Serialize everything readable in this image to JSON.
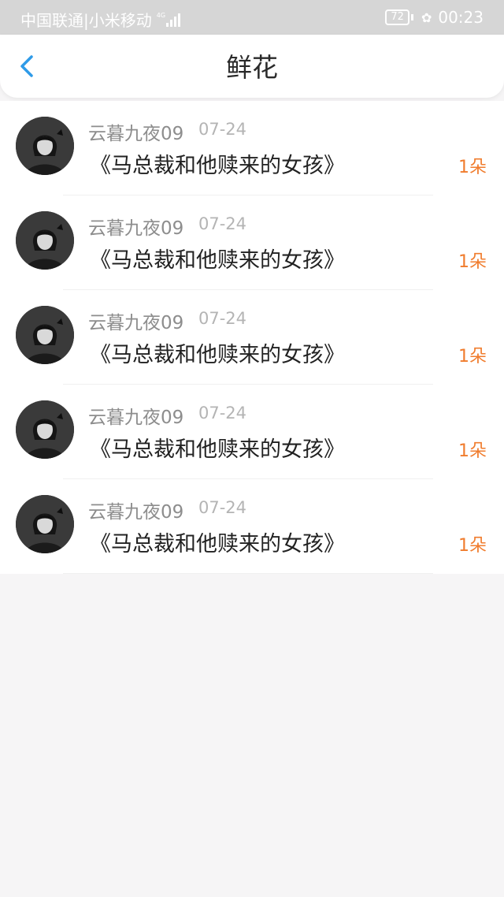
{
  "status_bar": {
    "carriers": "中国联通|小米移动",
    "network_type": "4G",
    "battery_level": "72",
    "time": "00:23"
  },
  "header": {
    "title": "鲜花",
    "back_icon": "chevron-left-icon"
  },
  "colors": {
    "accent": "#2f9be8",
    "count": "#f07c2d",
    "title": "#222222",
    "username": "#8d8d8d",
    "date": "#b4b4b4"
  },
  "records": [
    {
      "username": "云暮九夜09",
      "date": "07-24",
      "book_title": "《马总裁和他赎来的女孩》",
      "count": "1朵"
    },
    {
      "username": "云暮九夜09",
      "date": "07-24",
      "book_title": "《马总裁和他赎来的女孩》",
      "count": "1朵"
    },
    {
      "username": "云暮九夜09",
      "date": "07-24",
      "book_title": "《马总裁和他赎来的女孩》",
      "count": "1朵"
    },
    {
      "username": "云暮九夜09",
      "date": "07-24",
      "book_title": "《马总裁和他赎来的女孩》",
      "count": "1朵"
    },
    {
      "username": "云暮九夜09",
      "date": "07-24",
      "book_title": "《马总裁和他赎来的女孩》",
      "count": "1朵"
    }
  ]
}
